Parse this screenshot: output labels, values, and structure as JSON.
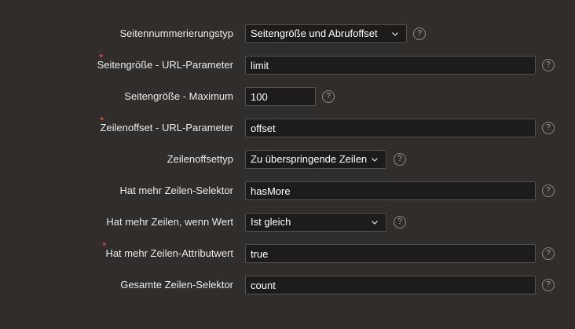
{
  "form": {
    "pagination_type": {
      "label": "Seitennummerierungstyp",
      "value": "Seitengröße und Abrufoffset",
      "help": "?"
    },
    "page_size_param": {
      "label": "Seitengröße - URL-Parameter",
      "value": "limit",
      "required": "*",
      "help": "?"
    },
    "page_size_max": {
      "label": "Seitengröße - Maximum",
      "value": "100",
      "help": "?"
    },
    "row_offset_param": {
      "label": "Zeilenoffset - URL-Parameter",
      "value": "offset",
      "required": "*",
      "help": "?"
    },
    "row_offset_type": {
      "label": "Zeilenoffsettyp",
      "value": "Zu überspringende Zeilen",
      "help": "?"
    },
    "has_more_selector": {
      "label": "Hat mehr Zeilen-Selektor",
      "value": "hasMore",
      "help": "?"
    },
    "has_more_when": {
      "label": "Hat mehr Zeilen, wenn Wert",
      "value": "Ist gleich",
      "help": "?"
    },
    "has_more_attr": {
      "label": "Hat mehr Zeilen-Attributwert",
      "value": "true",
      "required": "*",
      "help": "?"
    },
    "total_selector": {
      "label": "Gesamte Zeilen-Selektor",
      "value": "count",
      "help": "?"
    }
  },
  "icons": {
    "dropdown": "chevron-down-icon",
    "help": "question-circle-icon"
  }
}
